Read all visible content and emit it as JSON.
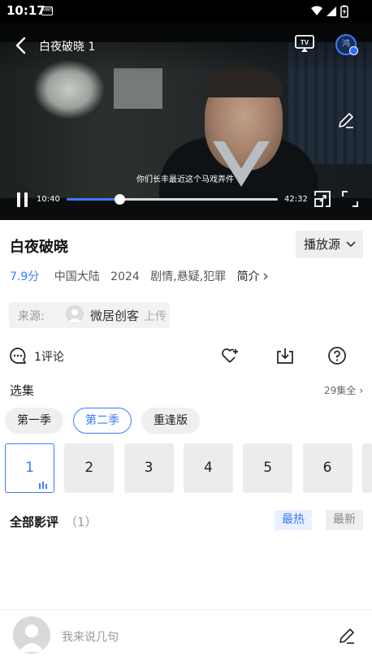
{
  "status_bar": {
    "time": "10:17",
    "notification_badge": "HMS"
  },
  "player": {
    "title": "白夜破晓 1",
    "subtitle": "你们长丰最近这个马戏弄件",
    "current_time": "10:40",
    "total_time": "42:32",
    "progress_fraction": 0.25,
    "avatar_text": "鸿"
  },
  "show": {
    "title": "白夜破晓",
    "source_button": "播放源",
    "score": "7.9分",
    "region": "中国大陆",
    "year": "2024",
    "genres": "剧情,悬疑,犯罪",
    "intro": "简介"
  },
  "uploader": {
    "label": "来源:",
    "name": "微居创客",
    "tag": "上传"
  },
  "actions": {
    "comment_count": "1评论"
  },
  "episodes": {
    "header": "选集",
    "all_label": "29集全",
    "seasons": [
      "第一季",
      "第二季",
      "重逢版"
    ],
    "active_season": 1,
    "items": [
      "1",
      "2",
      "3",
      "4",
      "5",
      "6"
    ],
    "active_episode": 0
  },
  "reviews": {
    "title": "全部影评",
    "count": "（1）",
    "sort_hot": "最热",
    "sort_new": "最新"
  },
  "composer": {
    "placeholder": "我来说几句"
  },
  "colors": {
    "accent": "#3a7bff"
  }
}
